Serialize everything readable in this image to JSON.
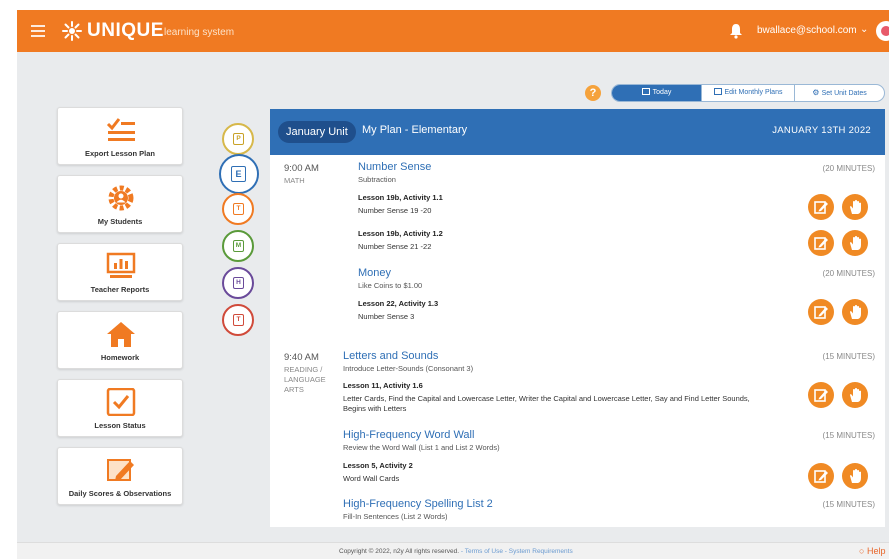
{
  "header": {
    "brand": "UNIQUE",
    "brand_sub": "learning system",
    "user_email": "bwallace@school.com",
    "caret": "⌄"
  },
  "toolbar": {
    "help": "?",
    "today_label": "Today",
    "edit_monthly_label": "Edit Monthly Plans",
    "set_unit_dates_label": "Set Unit Dates"
  },
  "tiles": [
    {
      "label": "Export Lesson Plan",
      "icon": "checklist-icon"
    },
    {
      "label": "My Students",
      "icon": "students-gear-icon"
    },
    {
      "label": "Teacher Reports",
      "icon": "reports-chart-icon"
    },
    {
      "label": "Homework",
      "icon": "house-icon"
    },
    {
      "label": "Lesson Status",
      "icon": "checkbox-icon"
    },
    {
      "label": "Daily Scores & Observations",
      "icon": "pencil-notes-icon"
    }
  ],
  "days": [
    {
      "letter": "P",
      "color": "#c9a227"
    },
    {
      "letter": "E",
      "color": "#2f6fb5"
    },
    {
      "letter": "T",
      "color": "#f07a22"
    },
    {
      "letter": "M",
      "color": "#5a9a3a"
    },
    {
      "letter": "H",
      "color": "#6a4a9a"
    },
    {
      "letter": "T",
      "color": "#d04a3a"
    }
  ],
  "plan": {
    "unit": "January Unit",
    "title": "My Plan - Elementary",
    "date": "JANUARY 13TH 2022"
  },
  "sessions": [
    {
      "time": "9:00 AM",
      "subject": "MATH",
      "lessons": [
        {
          "title": "Number Sense",
          "subtitle": "Subtraction",
          "minutes": "(20 MINUTES)",
          "activities": [
            {
              "name": "Lesson 19b, Activity 1.1",
              "detail": "Number Sense 19 -20"
            },
            {
              "name": "Lesson 19b, Activity 1.2",
              "detail": "Number Sense 21 -22"
            }
          ]
        },
        {
          "title": "Money",
          "subtitle": "Like Coins to $1.00",
          "minutes": "(20 MINUTES)",
          "activities": [
            {
              "name": "Lesson 22, Activity 1.3",
              "detail": "Number Sense 3"
            }
          ]
        }
      ]
    },
    {
      "time": "9:40 AM",
      "subject_lines": [
        "READING /",
        "LANGUAGE",
        "ARTS"
      ],
      "lessons": [
        {
          "title": "Letters and Sounds",
          "subtitle": "Introduce Letter-Sounds (Consonant 3)",
          "minutes": "(15 MINUTES)",
          "activities": [
            {
              "name": "Lesson 11, Activity 1.6",
              "detail_lines": [
                "Letter Cards, Find the Capital and Lowercase Letter, Writer the Capital and Lowercase Letter, Say and Find Letter Sounds,",
                "Begins with Letters"
              ]
            }
          ]
        },
        {
          "title": "High-Frequency Word Wall",
          "subtitle": "Review the Word Wall (List 1 and List 2 Words)",
          "minutes": "(15 MINUTES)",
          "activities": [
            {
              "name": "Lesson 5, Activity 2",
              "detail": "Word Wall Cards"
            }
          ]
        },
        {
          "title": "High-Frequency Spelling List 2",
          "subtitle": "Fill-In Sentences (List 2 Words)",
          "minutes": "(15 MINUTES)",
          "activities": []
        }
      ]
    }
  ],
  "footer": {
    "copyright": "Copyright © 2022, n2y All rights reserved.",
    "links": " - Terms of Use - System Requirements",
    "help": "Help"
  },
  "colors": {
    "brand_orange": "#f07a22",
    "brand_blue": "#2f6fb5",
    "action_orange": "#f08a24"
  }
}
